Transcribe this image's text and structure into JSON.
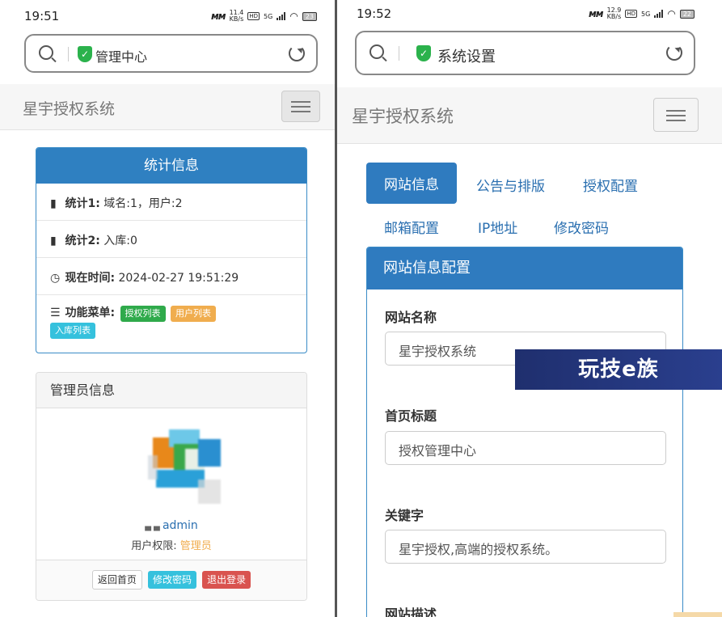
{
  "left": {
    "status": {
      "time": "19:51",
      "speed": "11.4\nKB/s",
      "battery": "23"
    },
    "urlbar": {
      "title": "管理中心"
    },
    "navbar": {
      "brand": "星宇授权系统"
    },
    "stats_panel": {
      "title": "统计信息",
      "rows": [
        {
          "label": "统计1:",
          "value": "域名:1，用户:2"
        },
        {
          "label": "统计2:",
          "value": "入库:0"
        },
        {
          "label": "现在时间:",
          "value": "2024-02-27 19:51:29"
        }
      ],
      "menu_label": "功能菜单:",
      "menu_tags": [
        "授权列表",
        "用户列表",
        "入库列表"
      ]
    },
    "admin_panel": {
      "title": "管理员信息",
      "username": "admin",
      "perm_label": "用户权限:",
      "perm_value": "管理员",
      "buttons": [
        "返回首页",
        "修改密码",
        "退出登录"
      ]
    }
  },
  "right": {
    "status": {
      "time": "19:52",
      "speed": "12.9\nKB/s",
      "battery": "22"
    },
    "urlbar": {
      "title": "系统设置"
    },
    "navbar": {
      "brand": "星宇授权系统"
    },
    "tabs": [
      "网站信息",
      "公告与排版",
      "授权配置",
      "邮箱配置",
      "IP地址",
      "修改密码"
    ],
    "panel": {
      "title": "网站信息配置",
      "fields": [
        {
          "label": "网站名称",
          "value": "星宇授权系统"
        },
        {
          "label": "首页标题",
          "value": "授权管理中心"
        },
        {
          "label": "关键字",
          "value": "星宇授权,高端的授权系统。"
        },
        {
          "label": "网站描述",
          "value": ""
        }
      ]
    }
  },
  "watermark": "玩技e族",
  "colors": {
    "primary": "#2f7bbf",
    "success": "#2faa4b",
    "warning": "#f0ad4e",
    "info": "#35c1dd",
    "danger": "#d9534f"
  }
}
